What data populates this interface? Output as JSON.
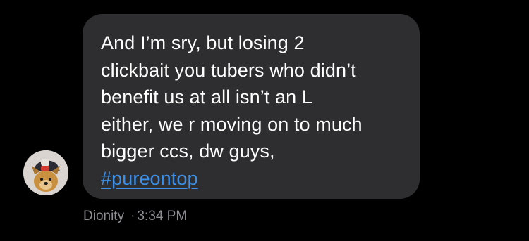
{
  "message": {
    "lines": [
      "And I’m sry, but losing 2",
      "clickbait you tubers who didn’t",
      "benefit us at all isn’t an L",
      "either, we r moving on to much",
      "bigger ccs, dw guys,"
    ],
    "hashtag": "#pureontop",
    "sender": "Dionity",
    "separator": "·",
    "time": "3:34 PM"
  },
  "colors": {
    "background": "#000000",
    "bubble": "#2e2e30",
    "text": "#ffffff",
    "link": "#3b8fe8",
    "meta": "#8e8e93"
  },
  "icons": {
    "avatar": "dog-avatar-icon"
  }
}
